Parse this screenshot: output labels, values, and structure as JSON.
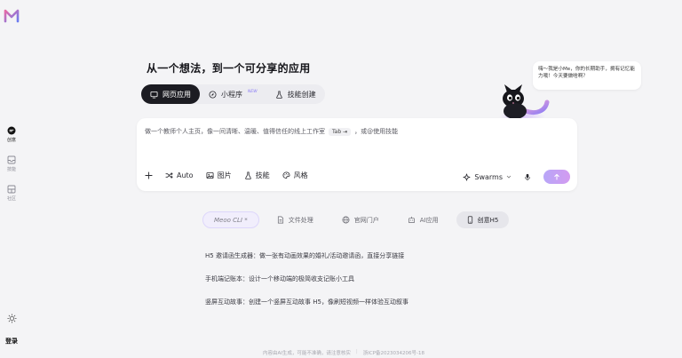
{
  "sidebar": {
    "items": [
      {
        "label": "创意",
        "icon": "chat-bubble-icon",
        "active": true
      },
      {
        "label": "技能",
        "icon": "inbox-icon",
        "active": false
      },
      {
        "label": "社区",
        "icon": "grid-icon",
        "active": false
      }
    ],
    "settings_icon": "sun-icon",
    "login_label": "登录"
  },
  "headline": "从一个想法，到一个可分享的应用",
  "modes": [
    {
      "label": "网页应用",
      "icon": "screen-icon",
      "active": true
    },
    {
      "label": "小程序",
      "icon": "compass-icon",
      "badge": "NEW",
      "active": false
    },
    {
      "label": "技能创建",
      "icon": "flask-icon",
      "active": false
    }
  ],
  "composer": {
    "placeholder": "做一个教师个人主页，像一间清晰、温暖、值得信任的线上工作室",
    "tab_key": "Tab ⇥",
    "hint": "，或@使用技能",
    "tools": [
      {
        "label": "",
        "icon": "plus-icon"
      },
      {
        "label": "Auto",
        "icon": "shuffle-icon"
      },
      {
        "label": "图片",
        "icon": "image-icon"
      },
      {
        "label": "技能",
        "icon": "flask-icon"
      },
      {
        "label": "风格",
        "icon": "palette-icon"
      }
    ],
    "model": "Swarms",
    "accent": "#c4a2f5"
  },
  "mascot": {
    "bubble": "嗨～我是小Me，你的长期助手，拥有记忆能力哦！今天要做啥啊？"
  },
  "feature_tabs": [
    {
      "label": "Meoo CLI *",
      "icon": "",
      "style": "cli"
    },
    {
      "label": "文件处理",
      "icon": "file-icon",
      "style": "normal"
    },
    {
      "label": "官网门户",
      "icon": "globe-icon",
      "style": "normal"
    },
    {
      "label": "AI应用",
      "icon": "robot-icon",
      "style": "normal"
    },
    {
      "label": "创意H5",
      "icon": "phone-icon",
      "style": "active"
    }
  ],
  "examples": [
    "H5 邀请函生成器：做一张有动画效果的婚礼/活动邀请函，直接分享链接",
    "手机端记账本：设计一个移动端的极简收支记账小工具",
    "竖屏互动故事：创建一个竖屏互动故事 H5，像刷短视频一样体验互动叙事"
  ],
  "footer": {
    "disclaimer": "内容由AI生成，可能不准确，请注意核实",
    "icp": "浙ICP备2023034206号-18"
  }
}
